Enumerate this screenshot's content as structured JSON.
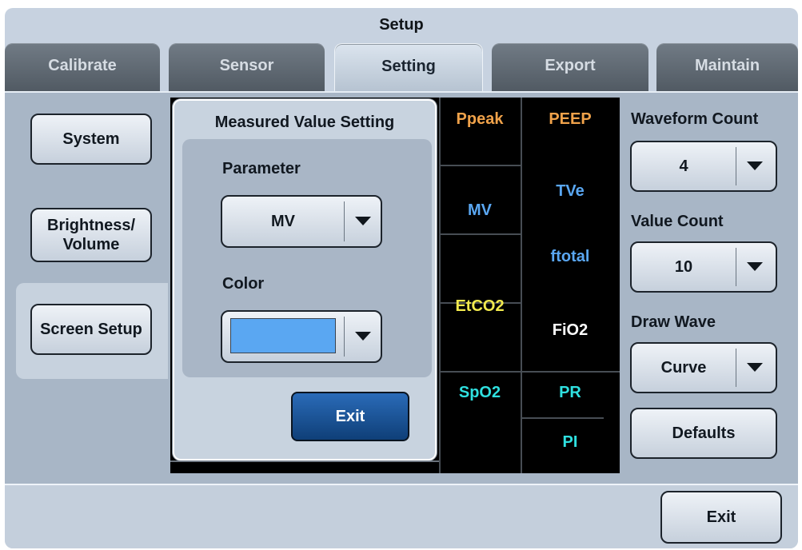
{
  "window": {
    "title": "Setup"
  },
  "tabs": [
    {
      "label": "Calibrate",
      "active": false
    },
    {
      "label": "Sensor",
      "active": false
    },
    {
      "label": "Setting",
      "active": true
    },
    {
      "label": "Export",
      "active": false
    },
    {
      "label": "Maintain",
      "active": false
    }
  ],
  "sidebar": {
    "items": [
      {
        "label": "System",
        "selected": false
      },
      {
        "label": "Brightness/ Volume",
        "selected": false
      },
      {
        "label": "Screen Setup",
        "selected": true
      }
    ]
  },
  "values_grid": {
    "cells": [
      {
        "label": "Ppeak",
        "color": "#f0a24a"
      },
      {
        "label": "PEEP",
        "color": "#f0a24a"
      },
      {
        "label": "TVe",
        "color": "#5aa7f2"
      },
      {
        "label": "MV",
        "color": "#5aa7f2"
      },
      {
        "label": "ftotal",
        "color": "#5aa7f2"
      },
      {
        "label": "EtCO2",
        "color": "#f2ea4e"
      },
      {
        "label": "FiO2",
        "color": "#ffffff"
      },
      {
        "label": "SpO2",
        "color": "#2fe0e0"
      },
      {
        "label": "PR",
        "color": "#2fe0e0"
      },
      {
        "label": "PI",
        "color": "#2fe0e0"
      }
    ]
  },
  "dialog": {
    "title": "Measured Value Setting",
    "parameter_label": "Parameter",
    "parameter_value": "MV",
    "color_label": "Color",
    "color_value": "#5aa7f2",
    "exit_label": "Exit"
  },
  "right_panel": {
    "waveform_count_label": "Waveform Count",
    "waveform_count_value": "4",
    "value_count_label": "Value Count",
    "value_count_value": "10",
    "draw_wave_label": "Draw Wave",
    "draw_wave_value": "Curve",
    "defaults_label": "Defaults"
  },
  "footer": {
    "exit_label": "Exit"
  },
  "icons": {
    "dropdown": "chevron-down-icon"
  }
}
